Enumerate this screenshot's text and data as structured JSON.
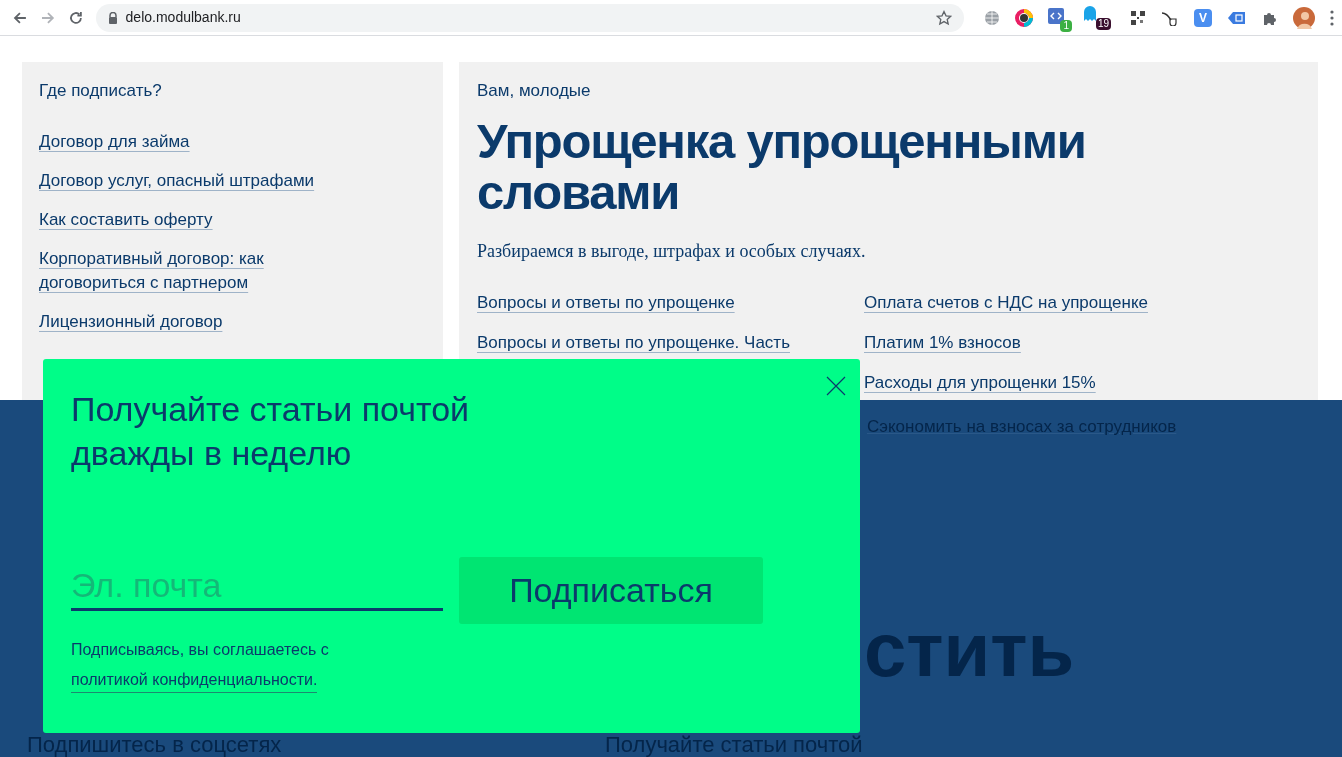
{
  "browser": {
    "url": "delo.modulbank.ru",
    "code_badge": "1",
    "ghost_badge": "19",
    "v_letter": "V"
  },
  "sidebar": {
    "title": "Где подписать?",
    "links": [
      "Договор для займа",
      "Договор услуг, опасный штрафами",
      "Как составить оферту",
      "Корпоративный договор: как договориться с партнером",
      "Лицензионный договор"
    ]
  },
  "article": {
    "eyebrow": "Вам, молодые",
    "title": "Упрощенка упрощенными словами",
    "lead": "Разбираемся в выгоде, штрафах и особых случаях.",
    "links_col1": [
      "Вопросы и ответы по упрощенке",
      "Вопросы и ответы по упрощенке. Часть"
    ],
    "links_col2": [
      "Оплата счетов с НДС на упрощенке",
      "Платим 1% взносов",
      "Расходы для упрощенки 15%"
    ]
  },
  "background": {
    "dimmed_link": "Сэкономить на взносах за сотрудников",
    "heading_fragment": "стить",
    "footer_headings": [
      "Подпишитесь в соцсетях",
      "Получайте статьи почтой"
    ]
  },
  "popup": {
    "title": "Получайте статьи почтой дважды в неделю",
    "email_placeholder": "Эл. почта",
    "button": "Подписаться",
    "consent": "Подписываясь, вы соглашаетесь с",
    "policy_link": "политикой конфиденциальности."
  }
}
